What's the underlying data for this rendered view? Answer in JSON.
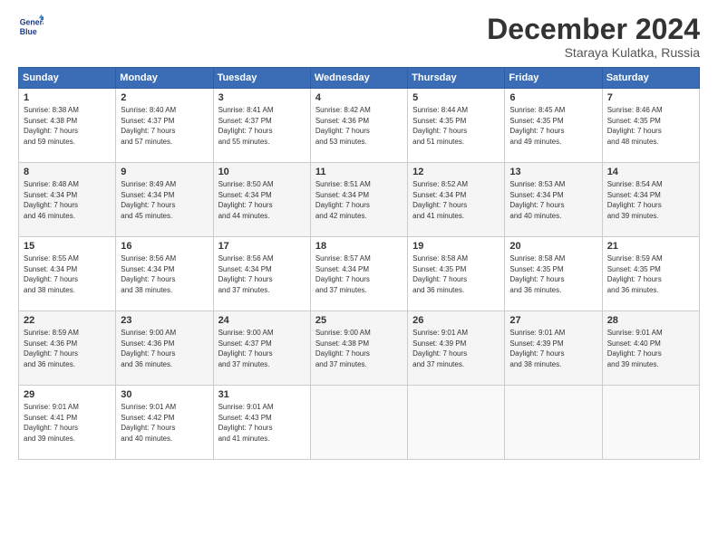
{
  "header": {
    "logo_line1": "General",
    "logo_line2": "Blue",
    "month": "December 2024",
    "location": "Staraya Kulatka, Russia"
  },
  "days_of_week": [
    "Sunday",
    "Monday",
    "Tuesday",
    "Wednesday",
    "Thursday",
    "Friday",
    "Saturday"
  ],
  "weeks": [
    [
      {
        "num": "1",
        "sunrise": "8:38 AM",
        "sunset": "4:38 PM",
        "daylight": "7 hours and 59 minutes."
      },
      {
        "num": "2",
        "sunrise": "8:40 AM",
        "sunset": "4:37 PM",
        "daylight": "7 hours and 57 minutes."
      },
      {
        "num": "3",
        "sunrise": "8:41 AM",
        "sunset": "4:37 PM",
        "daylight": "7 hours and 55 minutes."
      },
      {
        "num": "4",
        "sunrise": "8:42 AM",
        "sunset": "4:36 PM",
        "daylight": "7 hours and 53 minutes."
      },
      {
        "num": "5",
        "sunrise": "8:44 AM",
        "sunset": "4:35 PM",
        "daylight": "7 hours and 51 minutes."
      },
      {
        "num": "6",
        "sunrise": "8:45 AM",
        "sunset": "4:35 PM",
        "daylight": "7 hours and 49 minutes."
      },
      {
        "num": "7",
        "sunrise": "8:46 AM",
        "sunset": "4:35 PM",
        "daylight": "7 hours and 48 minutes."
      }
    ],
    [
      {
        "num": "8",
        "sunrise": "8:48 AM",
        "sunset": "4:34 PM",
        "daylight": "7 hours and 46 minutes."
      },
      {
        "num": "9",
        "sunrise": "8:49 AM",
        "sunset": "4:34 PM",
        "daylight": "7 hours and 45 minutes."
      },
      {
        "num": "10",
        "sunrise": "8:50 AM",
        "sunset": "4:34 PM",
        "daylight": "7 hours and 44 minutes."
      },
      {
        "num": "11",
        "sunrise": "8:51 AM",
        "sunset": "4:34 PM",
        "daylight": "7 hours and 42 minutes."
      },
      {
        "num": "12",
        "sunrise": "8:52 AM",
        "sunset": "4:34 PM",
        "daylight": "7 hours and 41 minutes."
      },
      {
        "num": "13",
        "sunrise": "8:53 AM",
        "sunset": "4:34 PM",
        "daylight": "7 hours and 40 minutes."
      },
      {
        "num": "14",
        "sunrise": "8:54 AM",
        "sunset": "4:34 PM",
        "daylight": "7 hours and 39 minutes."
      }
    ],
    [
      {
        "num": "15",
        "sunrise": "8:55 AM",
        "sunset": "4:34 PM",
        "daylight": "7 hours and 38 minutes."
      },
      {
        "num": "16",
        "sunrise": "8:56 AM",
        "sunset": "4:34 PM",
        "daylight": "7 hours and 38 minutes."
      },
      {
        "num": "17",
        "sunrise": "8:56 AM",
        "sunset": "4:34 PM",
        "daylight": "7 hours and 37 minutes."
      },
      {
        "num": "18",
        "sunrise": "8:57 AM",
        "sunset": "4:34 PM",
        "daylight": "7 hours and 37 minutes."
      },
      {
        "num": "19",
        "sunrise": "8:58 AM",
        "sunset": "4:35 PM",
        "daylight": "7 hours and 36 minutes."
      },
      {
        "num": "20",
        "sunrise": "8:58 AM",
        "sunset": "4:35 PM",
        "daylight": "7 hours and 36 minutes."
      },
      {
        "num": "21",
        "sunrise": "8:59 AM",
        "sunset": "4:35 PM",
        "daylight": "7 hours and 36 minutes."
      }
    ],
    [
      {
        "num": "22",
        "sunrise": "8:59 AM",
        "sunset": "4:36 PM",
        "daylight": "7 hours and 36 minutes."
      },
      {
        "num": "23",
        "sunrise": "9:00 AM",
        "sunset": "4:36 PM",
        "daylight": "7 hours and 36 minutes."
      },
      {
        "num": "24",
        "sunrise": "9:00 AM",
        "sunset": "4:37 PM",
        "daylight": "7 hours and 37 minutes."
      },
      {
        "num": "25",
        "sunrise": "9:00 AM",
        "sunset": "4:38 PM",
        "daylight": "7 hours and 37 minutes."
      },
      {
        "num": "26",
        "sunrise": "9:01 AM",
        "sunset": "4:39 PM",
        "daylight": "7 hours and 37 minutes."
      },
      {
        "num": "27",
        "sunrise": "9:01 AM",
        "sunset": "4:39 PM",
        "daylight": "7 hours and 38 minutes."
      },
      {
        "num": "28",
        "sunrise": "9:01 AM",
        "sunset": "4:40 PM",
        "daylight": "7 hours and 39 minutes."
      }
    ],
    [
      {
        "num": "29",
        "sunrise": "9:01 AM",
        "sunset": "4:41 PM",
        "daylight": "7 hours and 39 minutes."
      },
      {
        "num": "30",
        "sunrise": "9:01 AM",
        "sunset": "4:42 PM",
        "daylight": "7 hours and 40 minutes."
      },
      {
        "num": "31",
        "sunrise": "9:01 AM",
        "sunset": "4:43 PM",
        "daylight": "7 hours and 41 minutes."
      },
      null,
      null,
      null,
      null
    ]
  ]
}
